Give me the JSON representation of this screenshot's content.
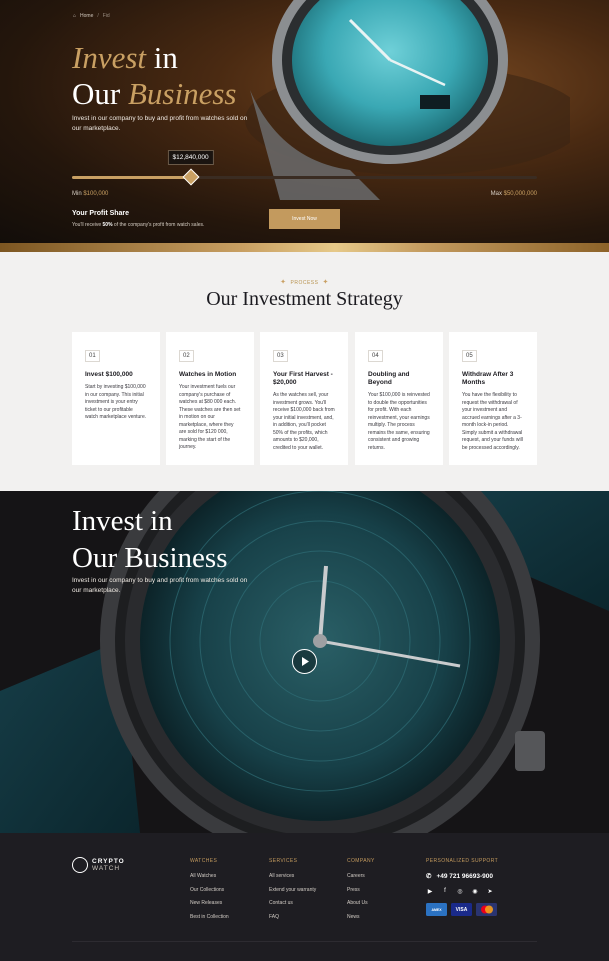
{
  "hero": {
    "breadcrumb": {
      "home": "Home",
      "separator": "/",
      "current": "Fid"
    },
    "title_word1": "Invest",
    "title_word2": " in",
    "title_word3": "Our ",
    "title_word4": "Business",
    "subtitle": "Invest in our company to buy and profit from watches sold on our marketplace.",
    "slider": {
      "value_label": "$12,840,000",
      "fraction": 0.255
    },
    "min_label": "Min",
    "min_value": "$100,000",
    "max_label": "Max",
    "max_value": "$50,000,000",
    "profit_title": "Your Profit Share",
    "profit_text_pre": "You'll receive ",
    "profit_percent": "50%",
    "profit_text_post": " of the company's profit from watch sales.",
    "cta_label": "Invest Now"
  },
  "strategy": {
    "eyebrow": "PROCESS",
    "title": "Our Investment Strategy",
    "cards": [
      {
        "num": "01",
        "title": "Invest $100,000",
        "text": "Start by investing $100,000 in our company. This initial investment is your entry ticket to our profitable watch marketplace venture."
      },
      {
        "num": "02",
        "title": "Watches in Motion",
        "text": "Your investment fuels our company's purchase of watches at $80 000 each. These watches are then set in motion on our marketplace, where they are sold for $120 000, marking the start of the journey."
      },
      {
        "num": "03",
        "title": "Your First Harvest - $20,000",
        "text": "As the watches sell, your investment grows. You'll receive $100,000 back from your initial investment, and, in addition, you'll pocket 50% of the profits, which amounts to $20,000, credited to your wallet."
      },
      {
        "num": "04",
        "title": "Doubling and Beyond",
        "text": "Your $100,000 is reinvested to double the opportunities for profit. With each reinvestment, your earnings multiply. The process remains the same, ensuring consistent and growing returns."
      },
      {
        "num": "05",
        "title": "Withdraw After 3 Months",
        "text": "You have the flexibility to request the withdrawal of your investment and accrued earnings after a 3-month lock-in period. Simply submit a withdrawal request, and your funds will be processed accordingly."
      }
    ]
  },
  "video": {
    "title_line1": "Invest in",
    "title_line2": "Our Business",
    "subtitle": "Invest in our company to buy and profit from watches sold on our marketplace.",
    "play_icon": "play-icon"
  },
  "footer": {
    "logo_line1": "CRYPTO",
    "logo_line2": "WATCH",
    "columns": [
      {
        "heading": "WATCHES",
        "links": [
          "All Watches",
          "Our Collections",
          "New Releases",
          "Best in Collection"
        ]
      },
      {
        "heading": "SERVICES",
        "links": [
          "All services",
          "Extend your warranty",
          "Contact us",
          "FAQ"
        ]
      },
      {
        "heading": "COMPANY",
        "links": [
          "Careers",
          "Press",
          "About Us",
          "News"
        ]
      }
    ],
    "support_heading": "PERSONALIZED SUPPORT",
    "phone": "+49 721 96693-900",
    "socials": [
      "youtube-icon",
      "facebook-icon",
      "instagram-icon",
      "whatsapp-icon",
      "telegram-icon"
    ],
    "payments": [
      "AMEX",
      "VISA",
      "mastercard"
    ]
  },
  "colors": {
    "accent": "#c9a063",
    "button": "#c39a5e",
    "dark": "#1e1d22",
    "light_bg": "#f2f1f0"
  }
}
